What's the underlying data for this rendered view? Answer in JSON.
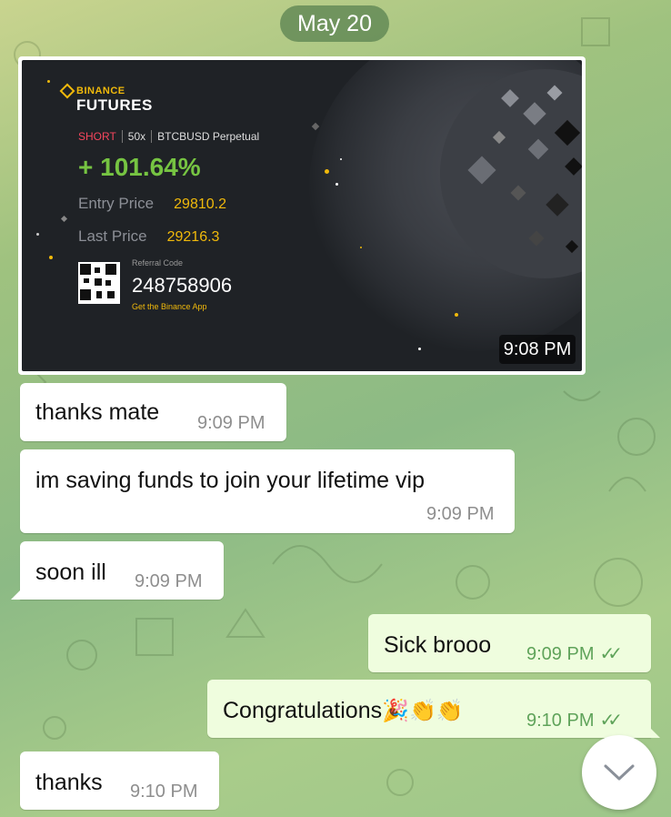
{
  "date_label": "May 20",
  "image_message": {
    "time": "9:08 PM",
    "card": {
      "brand": "BINANCE",
      "product": "FUTURES",
      "side": "SHORT",
      "leverage": "50x",
      "pair": "BTCBUSD Perpetual",
      "pnl": "+ 101.64%",
      "entry_label": "Entry Price",
      "entry_value": "29810.2",
      "last_label": "Last Price",
      "last_value": "29216.3",
      "referral_label": "Referral Code",
      "referral_code": "248758906",
      "app_text": "Get the Binance App"
    }
  },
  "messages": [
    {
      "direction": "in",
      "text": "thanks mate",
      "time": "9:09 PM"
    },
    {
      "direction": "in",
      "text": "im saving funds to join your lifetime vip",
      "time": "9:09 PM"
    },
    {
      "direction": "in",
      "text": "soon ill",
      "time": "9:09 PM"
    },
    {
      "direction": "out",
      "text": "Sick brooo",
      "time": "9:09 PM",
      "status": "read"
    },
    {
      "direction": "out",
      "text": "Congratulations",
      "emojis": "🎉👏👏",
      "time": "9:10 PM",
      "status": "read"
    },
    {
      "direction": "in",
      "text": "thanks",
      "time": "9:10 PM"
    }
  ],
  "icons": {
    "read_receipt": "double-check-icon",
    "scroll_down": "chevron-down-icon"
  },
  "colors": {
    "accent_green": "#5fa35a",
    "outgoing_bubble": "#effdde",
    "binance_yellow": "#f0b90b",
    "profit_green": "#76c442",
    "short_red": "#f6465d"
  }
}
